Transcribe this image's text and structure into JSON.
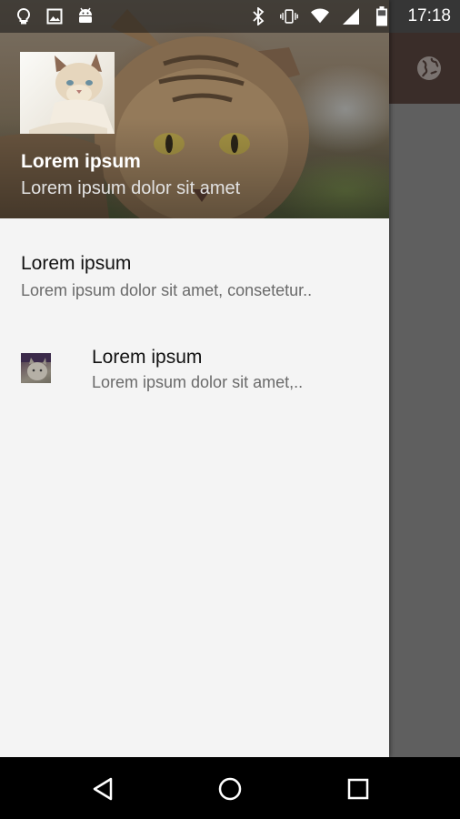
{
  "status_bar": {
    "time": "17:18",
    "left_icons": [
      "lightbulb-icon",
      "image-icon",
      "android-icon"
    ],
    "right_icons": [
      "bluetooth-icon",
      "vibrate-icon",
      "wifi-icon",
      "signal-icon",
      "battery-icon"
    ]
  },
  "app_bar": {
    "action_icon": "globe-icon"
  },
  "drawer": {
    "header": {
      "title": "Lorem ipsum",
      "subtitle": "Lorem ipsum dolor sit amet"
    },
    "items": [
      {
        "title": "Lorem ipsum",
        "subtitle": "Lorem ipsum dolor sit amet, consetetur.."
      },
      {
        "title": "Lorem ipsum",
        "subtitle": "Lorem ipsum dolor sit amet,.."
      }
    ]
  },
  "nav_bar": {
    "buttons": [
      "back-icon",
      "home-icon",
      "recents-icon"
    ]
  },
  "colors": {
    "app_bar": "#3a2d29",
    "scrim": "#5f5f5f",
    "drawer_bg": "#f4f4f4"
  }
}
